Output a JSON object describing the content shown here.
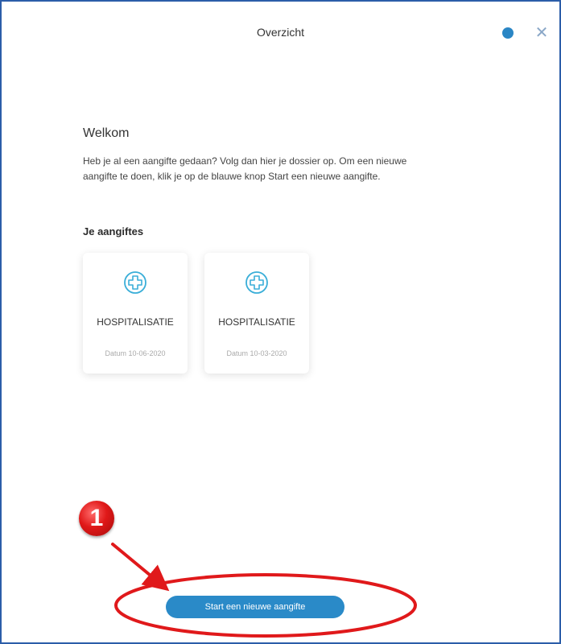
{
  "header": {
    "title": "Overzicht",
    "close_label": "✕"
  },
  "welcome": {
    "title": "Welkom",
    "text": "Heb je al een aangifte gedaan? Volg dan hier je dossier op. Om een nieuwe aangifte te doen, klik je op de blauwe knop Start een nieuwe aangifte."
  },
  "claims": {
    "section_title": "Je aangiftes",
    "items": [
      {
        "title": "HOSPITALISATIE",
        "date": "Datum 10-06-2020",
        "icon": "medical-plus-icon"
      },
      {
        "title": "HOSPITALISATIE",
        "date": "Datum 10-03-2020",
        "icon": "medical-plus-icon"
      }
    ]
  },
  "action": {
    "start_label": "Start een nieuwe aangifte"
  },
  "annotation": {
    "step_number": "1",
    "color": "#e0191b"
  },
  "colors": {
    "accent": "#2a8ac8",
    "frame_border": "#2c5da8",
    "icon": "#3aaed8"
  }
}
